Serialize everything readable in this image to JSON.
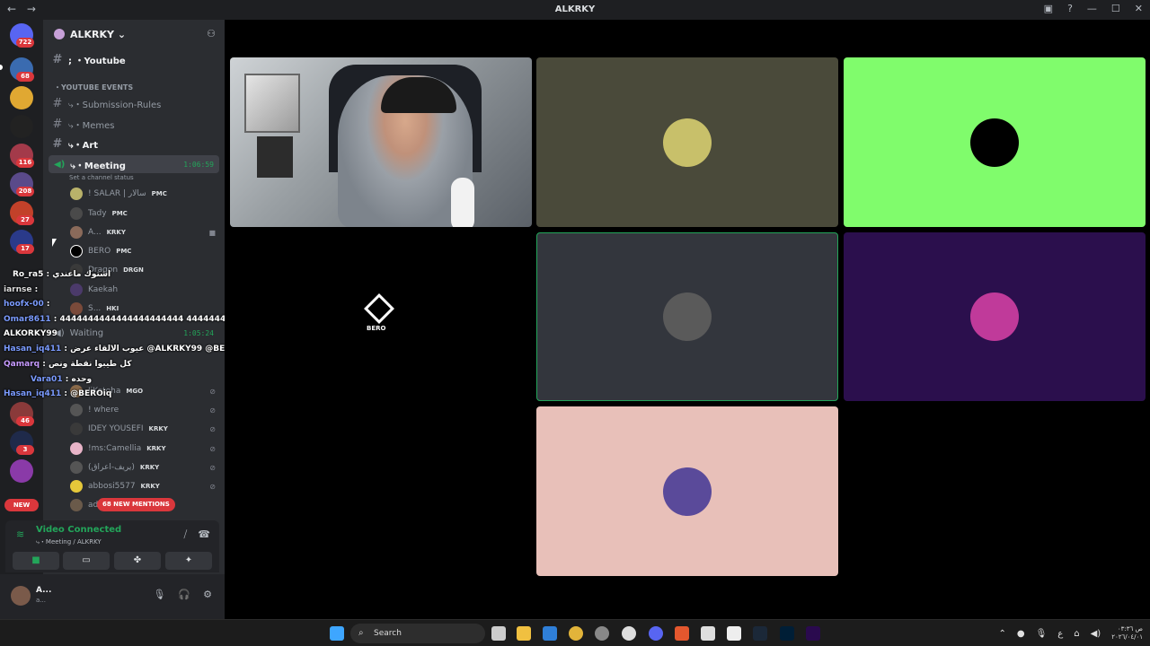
{
  "titlebar": {
    "title": "ALKRKY",
    "back_icon": "arrow-left-icon",
    "forward_icon": "arrow-right-icon",
    "window_controls": [
      "—",
      "☐",
      "✕"
    ]
  },
  "guilds": {
    "home_badge": "722",
    "badges": [
      "68",
      "116",
      "208",
      "27",
      "17",
      "46",
      "3"
    ],
    "new_label": "NEW"
  },
  "sidebar": {
    "server_name": "ALKRKY",
    "channels": [
      {
        "label": "; ・Youtube",
        "bold": true
      },
      {
        "label": "⤷・Submission-Rules",
        "bold": false
      },
      {
        "label": "⤷・Memes",
        "bold": false
      },
      {
        "label": "⤷・Art",
        "bold": true
      }
    ],
    "category": "・YOUTUBE EVENTS",
    "voice_channel": {
      "name": "⤷・Meeting",
      "timer": "1:06:59",
      "status_hint": "Set a channel status"
    },
    "members": [
      {
        "name": "! SALAR | سالار",
        "tag": "PMC",
        "color": "#b9b26a"
      },
      {
        "name": "Tady",
        "tag": "PMC",
        "color": "#4a4a4a"
      },
      {
        "name": "A...",
        "tag": "KRKY",
        "color": "#8a6a5a"
      },
      {
        "name": "BERO",
        "tag": "PMC",
        "color": "#000000"
      },
      {
        "name": "Dragon",
        "tag": "DRGN",
        "color": "#3a3a3a"
      },
      {
        "name": "Kaekah",
        "tag": "",
        "color": "#4b3a6a"
      },
      {
        "name": "S...",
        "tag": "HKI",
        "color": "#7a4a3a"
      }
    ],
    "waiting_channel": {
      "name": "Waiting",
      "timer": "1:05:24"
    },
    "waiting_members": [
      {
        "name": "IiKotoha",
        "tag": "MGO",
        "color": "#8a6a4a"
      },
      {
        "name": "! where",
        "tag": "",
        "color": "#555555"
      },
      {
        "name": "IDEY YOUSEFI",
        "tag": "KRKY",
        "color": "#3a3a3a"
      },
      {
        "name": "!ms:Camellia",
        "tag": "KRKY",
        "color": "#e8b4c8"
      },
      {
        "name": "(يريف-اعراق)",
        "tag": "KRKY",
        "color": "#555555"
      },
      {
        "name": "abbosi5577",
        "tag": "KRKY",
        "color": "#e5c83a"
      },
      {
        "name": "ad...",
        "tag": "",
        "color": "#6a5a4a"
      }
    ],
    "mentions_label": "68 NEW MENTIONS"
  },
  "chat_overlay": [
    {
      "name": "Ro_ra5",
      "text": ": اشتوك ماعندي"
    },
    {
      "name": "iarnse",
      "text": ":"
    },
    {
      "name": "hoofx-00",
      "text": ":"
    },
    {
      "name": "Omar8611",
      "text": ": 4444444444444444444444 4444444444"
    },
    {
      "name": "ALKORKY99",
      "text": ""
    },
    {
      "name": "Hasan_iq411",
      "text": ": عيوب الالقاء عرض @ALKRKY99 @BEROiq"
    },
    {
      "name": "Qamarq",
      "text": ": كل طيبوا نقطة ونص"
    },
    {
      "name": "Vara01",
      "text": ": وحده"
    },
    {
      "name": "Hasan_iq411",
      "text": ": @BEROiq"
    }
  ],
  "rtc": {
    "status": "Video Connected",
    "location": "⤷・Meeting / ALKRKY"
  },
  "user_panel": {
    "name": "A...",
    "status": "a..."
  },
  "stage": {
    "bero_label": "BERO",
    "tiles": [
      {
        "bg": "#4a4a3a",
        "avatar": "#c8c06a"
      },
      {
        "bg": "#80fc6c",
        "avatar": "#000000"
      },
      {
        "bg": "#33363d",
        "avatar": "#5a5a5a"
      },
      {
        "bg": "#2b0f4d",
        "avatar": "#c03a9a"
      },
      {
        "bg": "#e8c0b9",
        "avatar": "#5a4a9a"
      }
    ]
  },
  "taskbar": {
    "search_placeholder": "Search",
    "clock_time": "ص ٠٣:٣٦",
    "clock_date": "٢٠٢٦/٠٤/٠١"
  }
}
